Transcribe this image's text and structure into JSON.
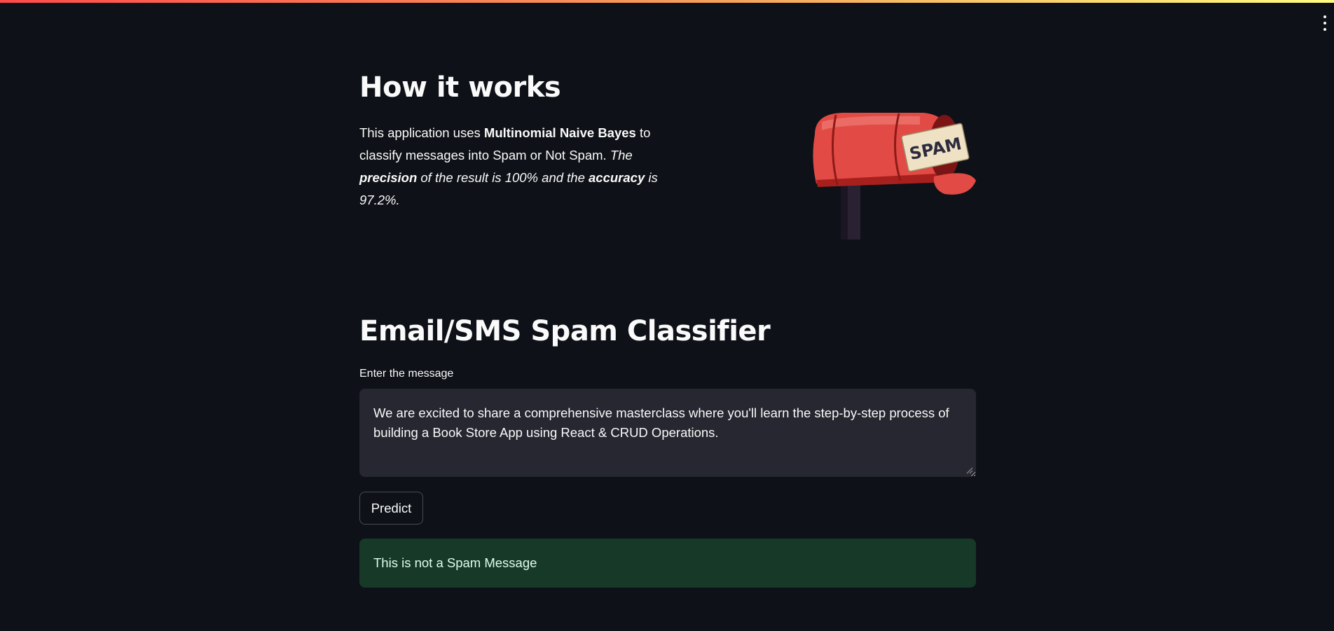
{
  "colors": {
    "background": "#0e1117",
    "text": "#fafafa",
    "input_background": "#262730",
    "success_background": "#173928",
    "success_text": "#dffde9",
    "mailbox_red": "#e24a45"
  },
  "menu": {
    "icon": "more-vertical-icon"
  },
  "how_it_works": {
    "title": "How it works",
    "intro": {
      "p1": "This application uses ",
      "algorithm": "Multinomial Naive Bayes",
      "p2": " to classify messages into Spam or Not Spam. ",
      "i1": "The ",
      "precision_word": "precision",
      "i2": " of the result is 100% and the ",
      "accuracy_word": "accuracy",
      "i3": " is 97.2%."
    },
    "image": {
      "icon": "spam-mailbox-illustration",
      "label": "SPAM"
    }
  },
  "classifier": {
    "title": "Email/SMS Spam Classifier",
    "input_label": "Enter the message",
    "message": "We are excited to share a comprehensive masterclass where you'll learn the step-by-step process of building a Book Store App using React & CRUD Operations.",
    "predict_label": "Predict",
    "result": "This is not a Spam Message"
  }
}
